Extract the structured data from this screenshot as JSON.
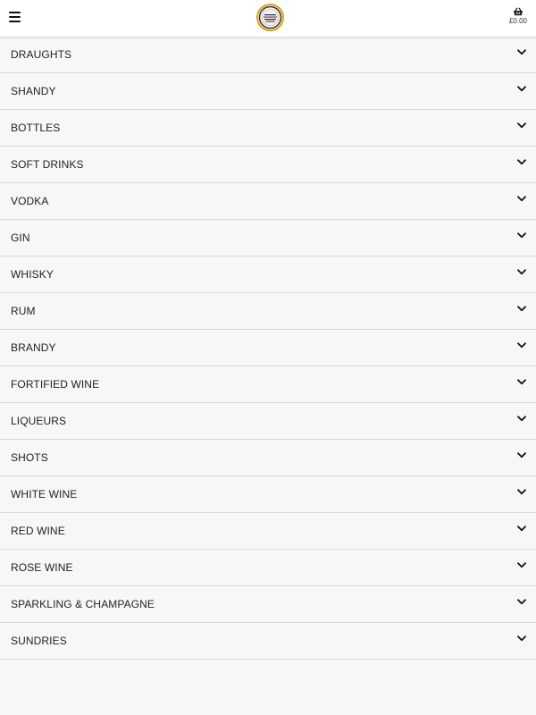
{
  "header": {
    "menu_icon": "hamburger-menu-icon",
    "logo_icon": "club-logo-icon",
    "basket_icon": "shopping-basket-icon",
    "basket_total": "£0.00"
  },
  "colors": {
    "header_bg": "#ffffff",
    "page_bg": "#f7f7f7",
    "divider": "#d9d9d9",
    "logo_ring": "#e0a500",
    "logo_inner": "#2a2a6e"
  },
  "categories": [
    {
      "label": "DRAUGHTS",
      "icon": "chevron-down-icon"
    },
    {
      "label": "SHANDY",
      "icon": "chevron-down-icon"
    },
    {
      "label": "BOTTLES",
      "icon": "chevron-down-icon"
    },
    {
      "label": "SOFT DRINKS",
      "icon": "chevron-down-icon"
    },
    {
      "label": "VODKA",
      "icon": "chevron-down-icon"
    },
    {
      "label": "GIN",
      "icon": "chevron-down-icon"
    },
    {
      "label": "WHISKY",
      "icon": "chevron-down-icon"
    },
    {
      "label": "RUM",
      "icon": "chevron-down-icon"
    },
    {
      "label": "BRANDY",
      "icon": "chevron-down-icon"
    },
    {
      "label": "FORTIFIED WINE",
      "icon": "chevron-down-icon"
    },
    {
      "label": "LIQUEURS",
      "icon": "chevron-down-icon"
    },
    {
      "label": "SHOTS",
      "icon": "chevron-down-icon"
    },
    {
      "label": "WHITE WINE",
      "icon": "chevron-down-icon"
    },
    {
      "label": "RED WINE",
      "icon": "chevron-down-icon"
    },
    {
      "label": "ROSE WINE",
      "icon": "chevron-down-icon"
    },
    {
      "label": "SPARKLING & CHAMPAGNE",
      "icon": "chevron-down-icon"
    },
    {
      "label": "SUNDRIES",
      "icon": "chevron-down-icon"
    }
  ]
}
